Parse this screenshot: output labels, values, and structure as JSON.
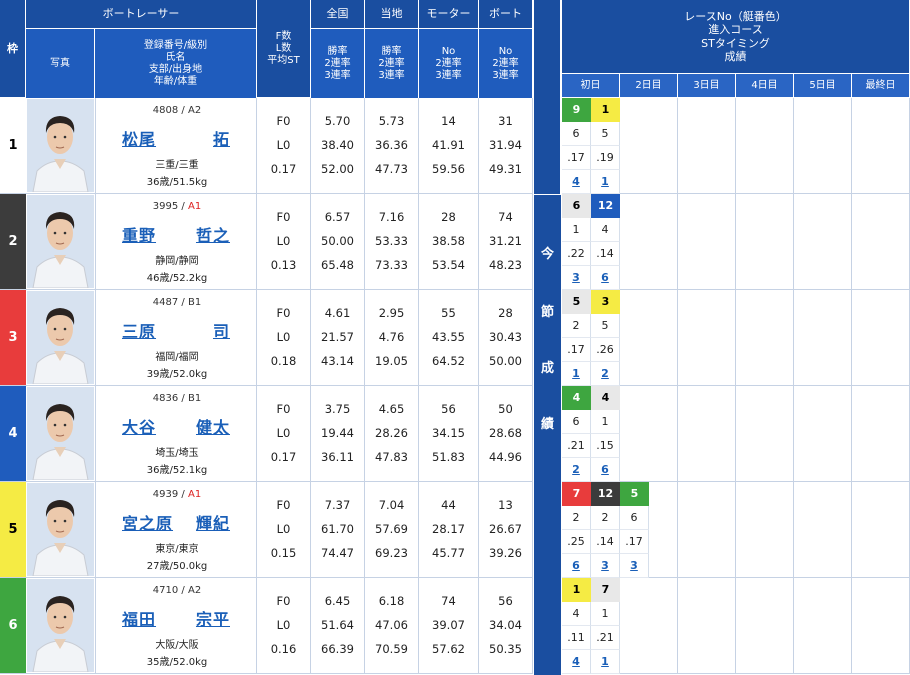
{
  "header": {
    "waku": "枠",
    "boat_racer": "ボートレーサー",
    "photo": "写真",
    "info_lines": [
      "登録番号/級別",
      "氏名",
      "支部/出身地",
      "年齢/体重"
    ],
    "st_lines": [
      "F数",
      "L数",
      "平均ST"
    ],
    "zenkoku": "全国",
    "touchi": "当地",
    "motor": "モーター",
    "boat": "ボート",
    "rate_lines": [
      "勝率",
      "2連率",
      "3連率"
    ],
    "no_lines": [
      "No",
      "2連率",
      "3連率"
    ],
    "results_lines": [
      "レースNo（艇番色）",
      "進入コース",
      "STタイミング",
      "成績"
    ],
    "days": [
      "初日",
      "2日目",
      "3日目",
      "4日目",
      "5日目",
      "最終日"
    ],
    "konsetsu": [
      "今",
      "節",
      "成",
      "績"
    ]
  },
  "colors": {
    "header": "#1a4ea0",
    "frame": [
      "#ffffff",
      "#3c3c3c",
      "#e83c3c",
      "#1f5cbd",
      "#f5eb44",
      "#3ea640"
    ]
  },
  "racers": [
    {
      "frame": "1",
      "reg": "4808 / ",
      "cls": "A2",
      "cls_red": false,
      "name1": "松尾",
      "name2": "拓",
      "branch": "三重/三重",
      "age": "36歳/51.5kg",
      "f": "F0",
      "l": "L0",
      "st": "0.17",
      "zen": [
        "5.70",
        "38.40",
        "52.00"
      ],
      "tou": [
        "5.73",
        "36.36",
        "47.73"
      ],
      "mot": [
        "14",
        "41.91",
        "59.56"
      ],
      "bot": [
        "31",
        "31.94",
        "49.31"
      ],
      "results": [
        {
          "race": "9",
          "race_color": 6,
          "course": "6",
          "st": ".17",
          "rank": "4"
        },
        {
          "race": "1",
          "race_color": 5,
          "course": "5",
          "st": ".19",
          "rank": "1"
        }
      ]
    },
    {
      "frame": "2",
      "reg": "3995 / ",
      "cls": "A1",
      "cls_red": true,
      "name1": "重野",
      "name2": "哲之",
      "branch": "静岡/静岡",
      "age": "46歳/52.2kg",
      "f": "F0",
      "l": "L0",
      "st": "0.13",
      "zen": [
        "6.57",
        "50.00",
        "65.48"
      ],
      "tou": [
        "7.16",
        "53.33",
        "73.33"
      ],
      "mot": [
        "28",
        "38.58",
        "53.54"
      ],
      "bot": [
        "74",
        "31.21",
        "48.23"
      ],
      "results": [
        {
          "race": "6",
          "race_color": 0,
          "course": "1",
          "st": ".22",
          "rank": "3"
        },
        {
          "race": "12",
          "race_color": 4,
          "course": "4",
          "st": ".14",
          "rank": "6"
        }
      ]
    },
    {
      "frame": "3",
      "reg": "4487 / ",
      "cls": "B1",
      "cls_red": false,
      "name1": "三原",
      "name2": "司",
      "branch": "福岡/福岡",
      "age": "39歳/52.0kg",
      "f": "F0",
      "l": "L0",
      "st": "0.18",
      "zen": [
        "4.61",
        "21.57",
        "43.14"
      ],
      "tou": [
        "2.95",
        "4.76",
        "19.05"
      ],
      "mot": [
        "55",
        "43.55",
        "64.52"
      ],
      "bot": [
        "28",
        "30.43",
        "50.00"
      ],
      "results": [
        {
          "race": "5",
          "race_color": 0,
          "course": "2",
          "st": ".17",
          "rank": "1"
        },
        {
          "race": "3",
          "race_color": 5,
          "course": "5",
          "st": ".26",
          "rank": "2"
        }
      ]
    },
    {
      "frame": "4",
      "reg": "4836 / ",
      "cls": "B1",
      "cls_red": false,
      "name1": "大谷",
      "name2": "健太",
      "branch": "埼玉/埼玉",
      "age": "36歳/52.1kg",
      "f": "F0",
      "l": "L0",
      "st": "0.17",
      "zen": [
        "3.75",
        "19.44",
        "36.11"
      ],
      "tou": [
        "4.65",
        "28.26",
        "47.83"
      ],
      "mot": [
        "56",
        "34.15",
        "51.83"
      ],
      "bot": [
        "50",
        "28.68",
        "44.96"
      ],
      "results": [
        {
          "race": "4",
          "race_color": 6,
          "course": "6",
          "st": ".21",
          "rank": "2"
        },
        {
          "race": "4",
          "race_color": 0,
          "course": "1",
          "st": ".15",
          "rank": "6"
        }
      ]
    },
    {
      "frame": "5",
      "reg": "4939 / ",
      "cls": "A1",
      "cls_red": true,
      "name1": "宮之原",
      "name2": "輝紀",
      "branch": "東京/東京",
      "age": "27歳/50.0kg",
      "f": "F0",
      "l": "L0",
      "st": "0.15",
      "zen": [
        "7.37",
        "61.70",
        "74.47"
      ],
      "tou": [
        "7.04",
        "57.69",
        "69.23"
      ],
      "mot": [
        "44",
        "28.17",
        "45.77"
      ],
      "bot": [
        "13",
        "26.67",
        "39.26"
      ],
      "results": [
        {
          "race": "7",
          "race_color": 3,
          "course": "2",
          "st": ".25",
          "rank": "6"
        },
        {
          "race": "12",
          "race_color": 2,
          "course": "2",
          "st": ".14",
          "rank": "3"
        },
        {
          "race": "5",
          "race_color": 6,
          "course": "6",
          "st": ".17",
          "rank": "3"
        }
      ]
    },
    {
      "frame": "6",
      "reg": "4710 / ",
      "cls": "A2",
      "cls_red": false,
      "name1": "福田",
      "name2": "宗平",
      "branch": "大阪/大阪",
      "age": "35歳/52.0kg",
      "f": "F0",
      "l": "L0",
      "st": "0.16",
      "zen": [
        "6.45",
        "51.64",
        "66.39"
      ],
      "tou": [
        "6.18",
        "47.06",
        "70.59"
      ],
      "mot": [
        "74",
        "39.07",
        "57.62"
      ],
      "bot": [
        "56",
        "34.04",
        "50.35"
      ],
      "results": [
        {
          "race": "1",
          "race_color": 5,
          "course": "4",
          "st": ".11",
          "rank": "4"
        },
        {
          "race": "7",
          "race_color": 0,
          "course": "1",
          "st": ".21",
          "rank": "1"
        }
      ]
    }
  ]
}
